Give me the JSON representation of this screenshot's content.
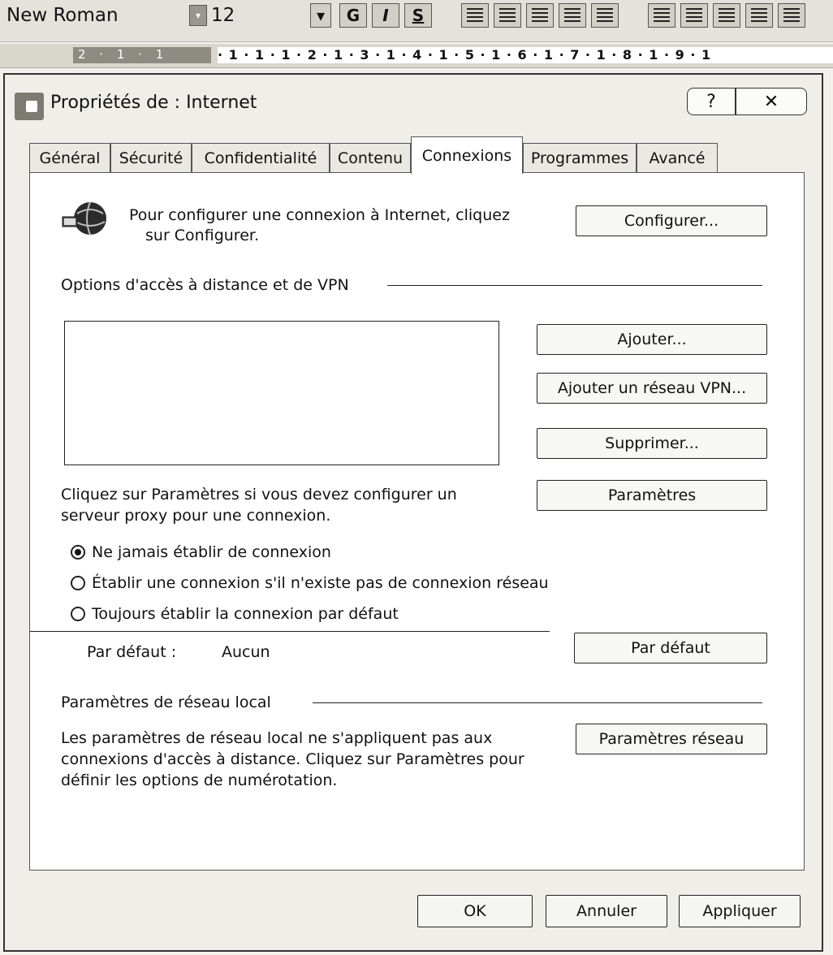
{
  "toolbar": {
    "font_name": "New Roman",
    "font_size": "12",
    "bold_label": "G",
    "italic_label": "I",
    "underline_label": "S"
  },
  "ruler": {
    "left_marks": "2 · 1 · 1",
    "scale": "· 1 · 1 · 1 · 2 · 1 · 3 · 1 · 4 · 1 · 5 · 1 · 6 · 1 · 7 · 1 · 8 · 1 · 9 · 1"
  },
  "dialog": {
    "title": "Propriétés de : Internet",
    "help_label": "?",
    "close_label": "✕",
    "tabs": [
      {
        "label": "Général"
      },
      {
        "label": "Sécurité"
      },
      {
        "label": "Confidentialité"
      },
      {
        "label": "Contenu"
      },
      {
        "label": "Connexions"
      },
      {
        "label": "Programmes"
      },
      {
        "label": "Avancé"
      }
    ],
    "active_tab": "Connexions",
    "setup": {
      "text_line1": "Pour configurer une connexion à Internet, cliquez",
      "text_line2": "sur Configurer.",
      "button": "Configurer..."
    },
    "dialup_vpn": {
      "section_title": "Options d'accès à distance et de VPN",
      "add_button": "Ajouter...",
      "add_vpn_button": "Ajouter un réseau VPN...",
      "remove_button": "Supprimer...",
      "settings_button": "Paramètres",
      "proxy_text_line1": "Cliquez sur Paramètres si vous devez configurer un",
      "proxy_text_line2": "serveur proxy pour une connexion.",
      "options": [
        {
          "label": "Ne jamais établir de connexion",
          "selected": true
        },
        {
          "label": "Établir une connexion s'il n'existe pas de connexion réseau",
          "selected": false
        },
        {
          "label": "Toujours établir la connexion par défaut",
          "selected": false
        }
      ],
      "default_label": "Par défaut :",
      "default_value": "Aucun",
      "set_default_button": "Par défaut"
    },
    "lan": {
      "section_title": "Paramètres de réseau local",
      "text_line1": "Les paramètres de réseau local ne s'appliquent pas aux",
      "text_line2": "connexions d'accès à distance. Cliquez sur Paramètres pour",
      "text_line3": "définir les options de numérotation.",
      "button": "Paramètres réseau"
    },
    "footer": {
      "ok": "OK",
      "cancel": "Annuler",
      "apply": "Appliquer"
    }
  }
}
